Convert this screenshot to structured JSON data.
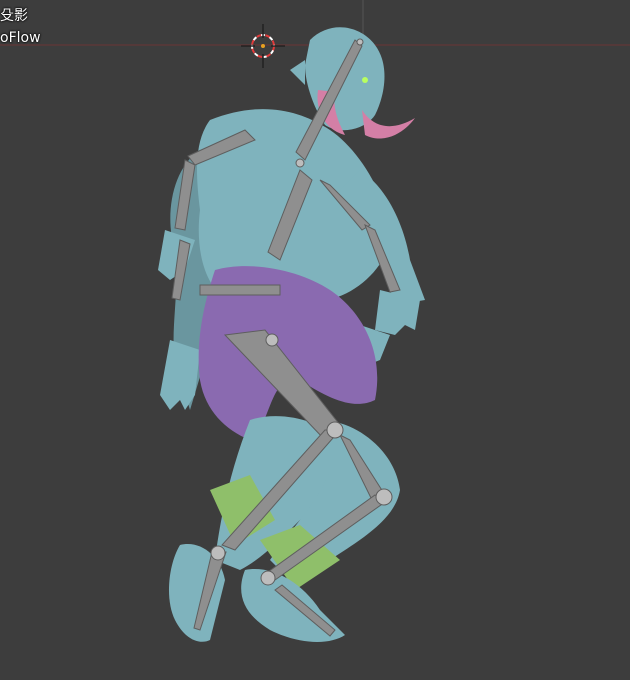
{
  "viewport": {
    "view_label": "殳影",
    "object_label": "oFlow",
    "background_color": "#3d3d3d",
    "grid_line_color": "#555555",
    "axis_x_color": "#7a3a3a"
  },
  "scene": {
    "character": {
      "skin_color": "#7fb3bd",
      "loincloth_color": "#8a6ab0",
      "horn_color": "#d47fa6",
      "bracer_color": "#8fbf6a",
      "bone_color": "#8f8f8f"
    },
    "cursor": {
      "icon": "3d-cursor-icon"
    }
  }
}
